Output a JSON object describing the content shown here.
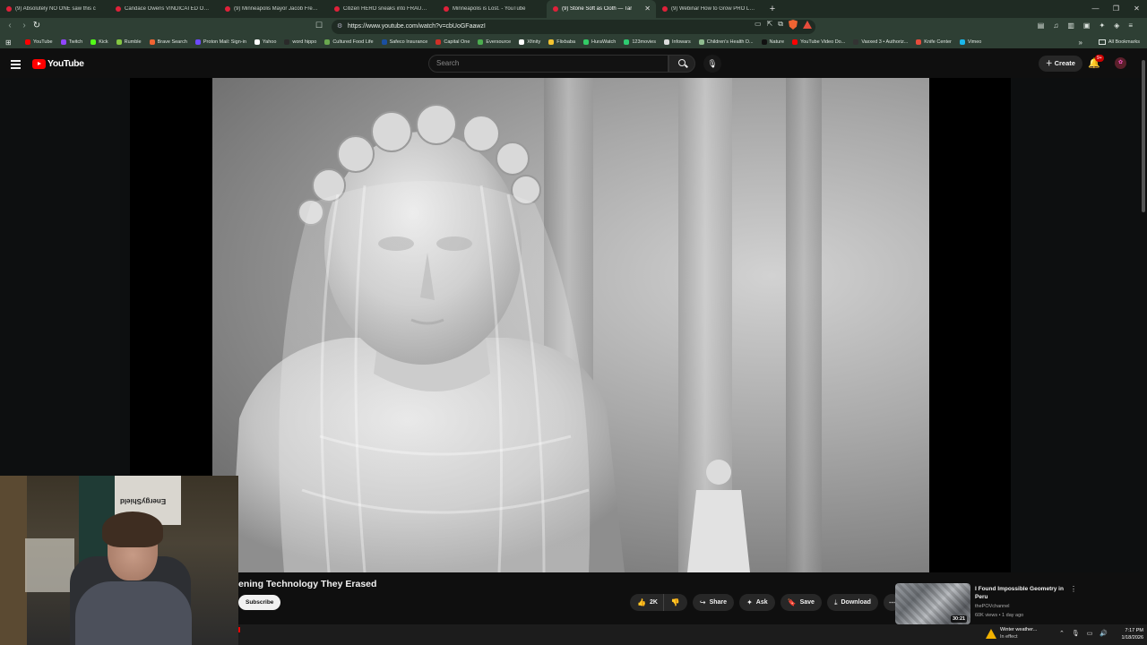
{
  "browser": {
    "tabs": [
      {
        "title": "(9) Absolutely NO ONE saw this c"
      },
      {
        "title": "Candace Owens VINDICATED Over F"
      },
      {
        "title": "(9) Minneapolis Mayor Jacob Frey ca"
      },
      {
        "title": "Citizen HERO sneaks into FRAUD CE"
      },
      {
        "title": "Minneapolis is Lost. - YouTube"
      },
      {
        "title": "(9) Stone Soft as Cloth — Tar",
        "active": true
      },
      {
        "title": "(9) Webinar How to Grow PRO Level"
      }
    ],
    "new_tab": "+",
    "url": "https://www.youtube.com/watch?v=cbUoGFaawzI",
    "bookmarks": [
      {
        "label": "YouTube",
        "color": "#ff0000"
      },
      {
        "label": "Twitch",
        "color": "#9146ff"
      },
      {
        "label": "Kick",
        "color": "#53fc18"
      },
      {
        "label": "Rumble",
        "color": "#85c742"
      },
      {
        "label": "Brave Search",
        "color": "#f06432"
      },
      {
        "label": "Proton Mail: Sign-in",
        "color": "#6d4aff"
      },
      {
        "label": "Yahoo",
        "color": "#ffffff"
      },
      {
        "label": "word hippo",
        "color": "#2a2a2a"
      },
      {
        "label": "Cultured Food Life",
        "color": "#6aa84f"
      },
      {
        "label": "Safeco Insurance",
        "color": "#1a4fa0"
      },
      {
        "label": "Capital One",
        "color": "#d03027"
      },
      {
        "label": "Eversource",
        "color": "#4cae4f"
      },
      {
        "label": "Xfinity",
        "color": "#ffffff"
      },
      {
        "label": "Flixbaba",
        "color": "#f4c430"
      },
      {
        "label": "HuraWatch",
        "color": "#33cc66"
      },
      {
        "label": "123movies",
        "color": "#2ecc71"
      },
      {
        "label": "Infowars",
        "color": "#dddddd"
      },
      {
        "label": "Children's Health D...",
        "color": "#8fbc8f"
      },
      {
        "label": "Nature",
        "color": "#111111"
      },
      {
        "label": "YouTube Video Do...",
        "color": "#ff0000"
      },
      {
        "label": "Vaxxed 3 • Authoriz...",
        "color": "#333333"
      },
      {
        "label": "Knife Center",
        "color": "#e74c3c"
      },
      {
        "label": "Vimeo",
        "color": "#1ab7ea"
      }
    ],
    "all_bookmarks": "All Bookmarks"
  },
  "youtube": {
    "logo_text": "YouTube",
    "search_placeholder": "Search",
    "create_label": "Create",
    "notification_count": "9+",
    "video_title": "ening Technology They Erased",
    "subscribe_label": "Subscribe",
    "likes": "2K",
    "share_label": "Share",
    "ask_label": "Ask",
    "save_label": "Save",
    "download_label": "Download",
    "recommendation": {
      "title": "I Found Impossible Geometry in Peru",
      "channel": "thePOVchannel",
      "meta": "60K views • 1 day ago",
      "duration": "30:21"
    }
  },
  "webcam": {
    "banner_text": "EnergyShield"
  },
  "taskbar": {
    "weather_title": "Winter weather...",
    "weather_sub": "In effect",
    "time": "7:17 PM",
    "date": "1/18/2026"
  }
}
